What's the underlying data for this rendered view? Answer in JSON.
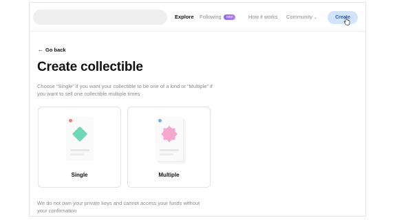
{
  "header": {
    "nav": {
      "explore": "Explore",
      "following": "Following",
      "following_badge": "new",
      "how_it_works": "How it works",
      "community": "Community"
    },
    "create_label": "Create"
  },
  "main": {
    "go_back": "Go back",
    "title": "Create collectible",
    "subtitle": "Choose “Single” if you want your collectible to be one of a kind or “Multiple” if you want to sell one collectible multiple times",
    "options": [
      {
        "label": "Single",
        "shape_color": "#6fd6b8",
        "dot_color": "#f07a7a"
      },
      {
        "label": "Multiple",
        "shape_color": "#f8a8cf",
        "dot_color": "#6fb0e8"
      }
    ],
    "disclaimer": "We do not own your private keys and cannot access your funds without your confirmation"
  },
  "colors": {
    "accent": "#1e5fc8",
    "create_bg": "#d2e4fb"
  }
}
